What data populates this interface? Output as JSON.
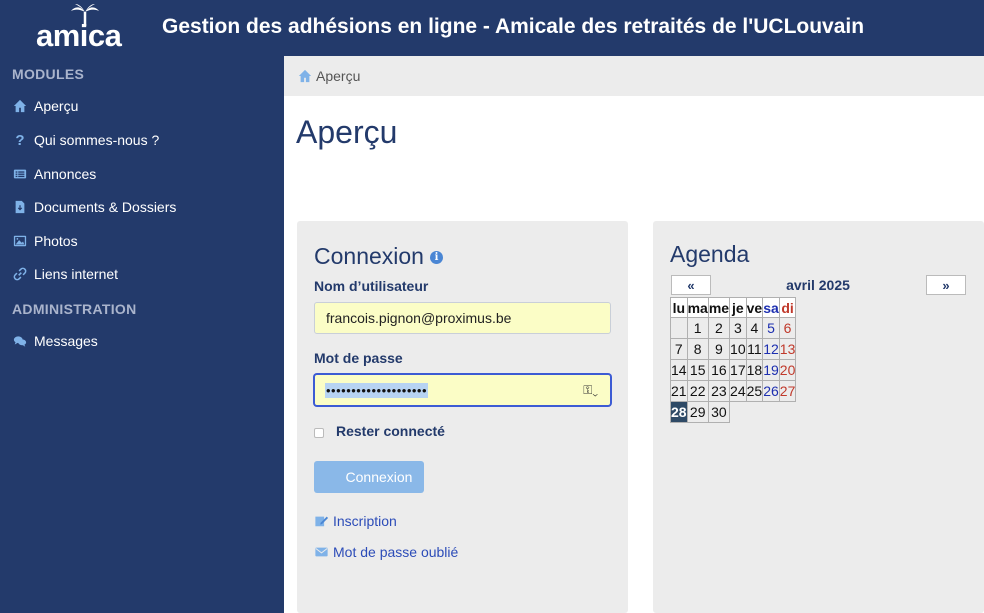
{
  "header": {
    "logo_text": "amica",
    "title": "Gestion des adhésions en ligne - Amicale des retraités de l'UCLouvain"
  },
  "sidebar": {
    "modules_heading": "MODULES",
    "admin_heading": "ADMINISTRATION",
    "modules": [
      {
        "label": "Aperçu",
        "icon": "home-icon"
      },
      {
        "label": "Qui sommes-nous ?",
        "icon": "question-icon"
      },
      {
        "label": "Annonces",
        "icon": "list-icon"
      },
      {
        "label": "Documents & Dossiers",
        "icon": "file-icon"
      },
      {
        "label": "Photos",
        "icon": "image-icon"
      },
      {
        "label": "Liens internet",
        "icon": "link-icon"
      }
    ],
    "admin": [
      {
        "label": "Messages",
        "icon": "comments-icon"
      }
    ]
  },
  "breadcrumb": {
    "label": "Aperçu"
  },
  "page": {
    "title": "Aperçu"
  },
  "login": {
    "title": "Connexion",
    "username_label": "Nom d’utilisateur",
    "username_value": "francois.pignon@proximus.be",
    "password_label": "Mot de passe",
    "password_value": "••••••••••••••••••••",
    "remember_label": "Rester connecté",
    "remember_checked": false,
    "submit_label": "Connexion",
    "register_link": "Inscription",
    "forgot_link": "Mot de passe oublié"
  },
  "agenda": {
    "title": "Agenda",
    "prev": "«",
    "next": "»",
    "month": "avril 2025",
    "weekdays": [
      "lu",
      "ma",
      "me",
      "je",
      "ve",
      "sa",
      "di"
    ],
    "weeks": [
      [
        "",
        "1",
        "2",
        "3",
        "4",
        "5",
        "6"
      ],
      [
        "7",
        "8",
        "9",
        "10",
        "11",
        "12",
        "13"
      ],
      [
        "14",
        "15",
        "16",
        "17",
        "18",
        "19",
        "20"
      ],
      [
        "21",
        "22",
        "23",
        "24",
        "25",
        "26",
        "27"
      ],
      [
        "28",
        "29",
        "30"
      ]
    ],
    "today": "28"
  },
  "colors": {
    "navy": "#233a6b",
    "panel": "#ececec",
    "input_fill": "#fbfdc6",
    "button": "#8ab8e8",
    "link": "#2c4cb8",
    "saturday": "#1d2fb0",
    "sunday": "#c0392b",
    "today": "#2e4a66"
  }
}
